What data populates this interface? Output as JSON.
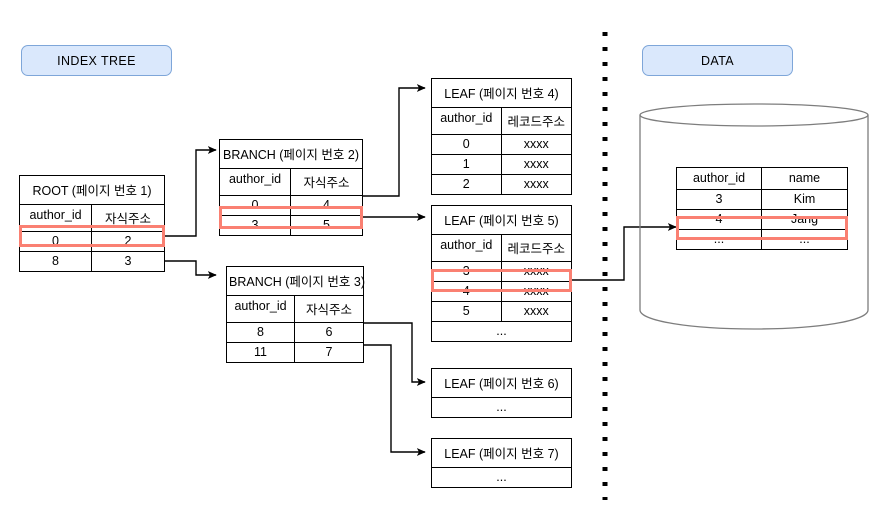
{
  "diagram": {
    "title_left": "INDEX TREE",
    "title_right": "DATA",
    "highlight_color": "#fa8072",
    "badge_color": "#dae8fc",
    "badge_border_color": "#7ea6d9"
  },
  "nodes": {
    "root": {
      "title": "ROOT (페이지 번호 1)",
      "columns": [
        "author_id",
        "자식주소"
      ],
      "rows": [
        {
          "author_id": "0",
          "child": "2",
          "highlighted": true
        },
        {
          "author_id": "8",
          "child": "3",
          "highlighted": false
        }
      ]
    },
    "branch2": {
      "title": "BRANCH (페이지 번호 2)",
      "columns": [
        "author_id",
        "자식주소"
      ],
      "rows": [
        {
          "author_id": "0",
          "child": "4",
          "highlighted": false
        },
        {
          "author_id": "3",
          "child": "5",
          "highlighted": true
        }
      ]
    },
    "branch3": {
      "title": "BRANCH (페이지 번호 3)",
      "columns": [
        "author_id",
        "자식주소"
      ],
      "rows": [
        {
          "author_id": "8",
          "child": "6",
          "highlighted": false
        },
        {
          "author_id": "11",
          "child": "7",
          "highlighted": false
        }
      ]
    },
    "leaf4": {
      "title": "LEAF (페이지 번호 4)",
      "columns": [
        "author_id",
        "레코드주소"
      ],
      "rows": [
        {
          "author_id": "0",
          "addr": "xxxx",
          "highlighted": false
        },
        {
          "author_id": "1",
          "addr": "xxxx",
          "highlighted": false
        },
        {
          "author_id": "2",
          "addr": "xxxx",
          "highlighted": false
        }
      ]
    },
    "leaf5": {
      "title": "LEAF (페이지 번호 5)",
      "columns": [
        "author_id",
        "레코드주소"
      ],
      "rows": [
        {
          "author_id": "3",
          "addr": "xxxx",
          "highlighted": false
        },
        {
          "author_id": "4",
          "addr": "xxxx",
          "highlighted": true
        },
        {
          "author_id": "5",
          "addr": "xxxx",
          "highlighted": false
        }
      ],
      "ellipsis": "..."
    },
    "leaf6": {
      "title": "LEAF (페이지 번호 6)",
      "ellipsis": "..."
    },
    "leaf7": {
      "title": "LEAF (페이지 번호 7)",
      "ellipsis": "..."
    },
    "data_table": {
      "columns": [
        "author_id",
        "name"
      ],
      "rows": [
        {
          "author_id": "3",
          "name": "Kim",
          "highlighted": false
        },
        {
          "author_id": "4",
          "name": "Jang",
          "highlighted": true
        },
        {
          "author_id": "...",
          "name": "...",
          "highlighted": false
        }
      ]
    }
  }
}
